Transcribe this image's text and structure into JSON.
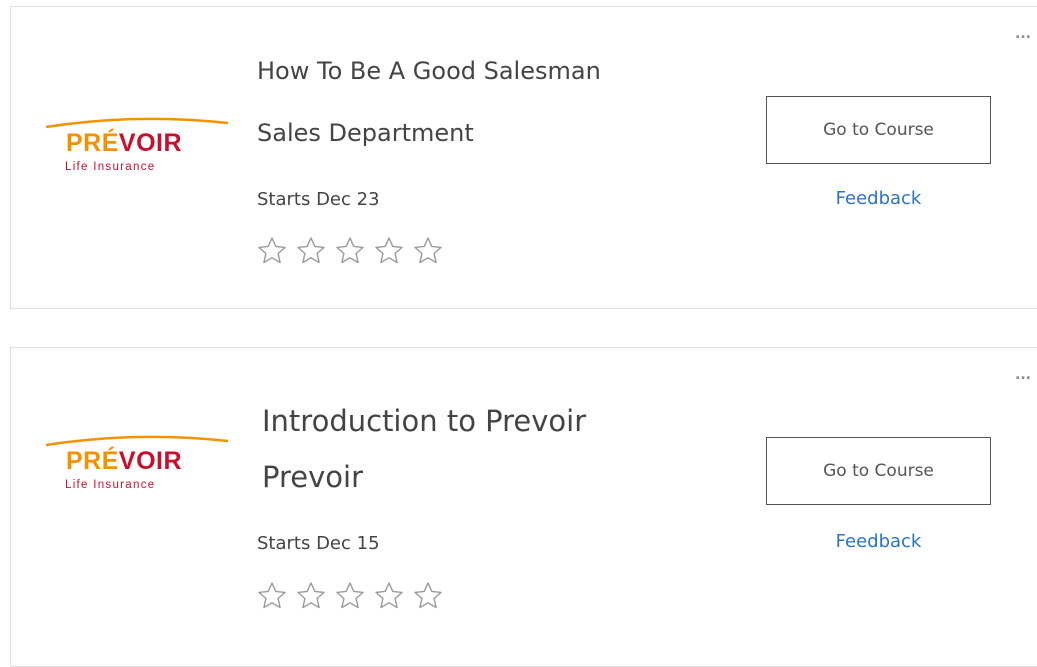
{
  "courses": [
    {
      "logo": {
        "brand_part1": "PRÉ",
        "brand_part2": "VOIR",
        "tagline": "Life Insurance"
      },
      "title": "How To Be A Good Salesman",
      "subtitle": "Sales Department",
      "starts": "Starts Dec 23",
      "rating": 0,
      "max_rating": 5,
      "go_button": "Go to Course",
      "feedback_link": "Feedback",
      "more_menu": "..."
    },
    {
      "logo": {
        "brand_part1": "PRÉ",
        "brand_part2": "VOIR",
        "tagline": "Life Insurance"
      },
      "title": "Introduction to Prevoir",
      "subtitle": "Prevoir",
      "starts": "Starts Dec 15",
      "rating": 0,
      "max_rating": 5,
      "go_button": "Go to Course",
      "feedback_link": "Feedback",
      "more_menu": "..."
    }
  ],
  "colors": {
    "brand_orange": "#f39200",
    "brand_red": "#c8102e",
    "link_blue": "#2a73c5",
    "text": "#444444"
  }
}
